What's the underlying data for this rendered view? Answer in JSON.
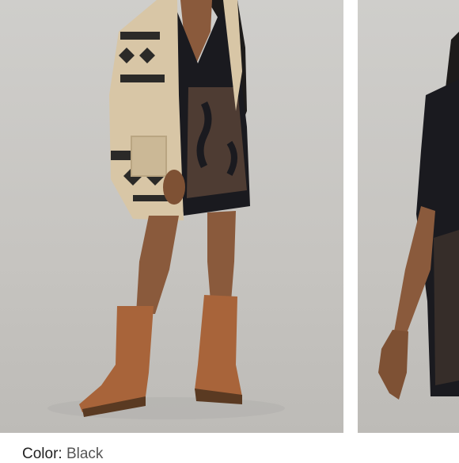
{
  "product": {
    "images": [
      {
        "icon": "model-photo-front"
      },
      {
        "icon": "model-photo-side"
      }
    ],
    "color_label": "Color:",
    "color_value": "Black"
  },
  "colors": {
    "background": "#ffffff",
    "photo_backdrop": "#c9c7c3",
    "cardigan": "#d8c6a6",
    "dress": "#1a1a1f",
    "boots": "#a8643a"
  }
}
